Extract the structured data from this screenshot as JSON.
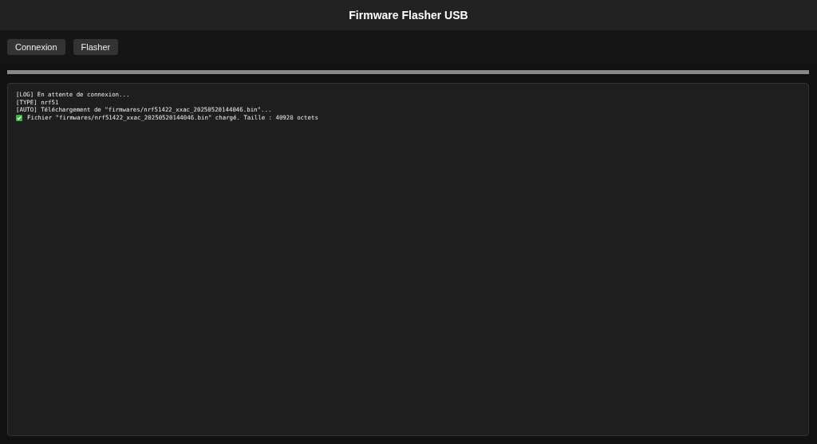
{
  "header": {
    "title": "Firmware Flasher USB"
  },
  "buttons": [
    "Connexion",
    "Flasher"
  ],
  "log": [
    {
      "kind": "plain",
      "text": "[LOG] En attente de connexion..."
    },
    {
      "kind": "plain",
      "text": "[TYPE] nrf51"
    },
    {
      "kind": "plain",
      "text": "[AUTO] Téléchargement de \"firmwares/nrf51422_xxac_20250520144046.bin\"..."
    },
    {
      "kind": "success",
      "text": "Fichier \"firmwares/nrf51422_xxac_20250520144046.bin\" chargé. Taille : 40928 octets"
    }
  ]
}
